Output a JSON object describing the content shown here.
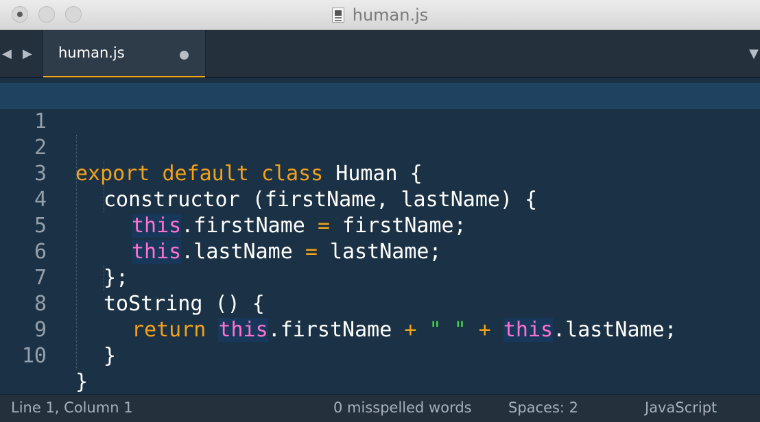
{
  "window": {
    "title": "human.js",
    "controls": [
      "close",
      "minimize",
      "zoom"
    ]
  },
  "tabs": {
    "nav_left_icon": "triangle-left-icon",
    "nav_right_icon": "triangle-right-icon",
    "menu_icon": "triangle-down-icon",
    "items": [
      {
        "label": "human.js",
        "active": true,
        "dirty": true
      }
    ]
  },
  "editor": {
    "current_line": 1,
    "lines": [
      {
        "number": "1"
      },
      {
        "number": "2"
      },
      {
        "number": "3"
      },
      {
        "number": "4"
      },
      {
        "number": "5"
      },
      {
        "number": "6"
      },
      {
        "number": "7"
      },
      {
        "number": "8"
      },
      {
        "number": "9"
      },
      {
        "number": "10"
      }
    ],
    "tokens": {
      "l2": [
        "export",
        " ",
        "default",
        " ",
        "class",
        " Human {"
      ],
      "l3": [
        "constructor (firstName, lastName) {"
      ],
      "l4": [
        "this",
        ".firstName ",
        "=",
        " firstName;"
      ],
      "l5": [
        "this",
        ".lastName ",
        "=",
        " lastName;"
      ],
      "l6": [
        "};"
      ],
      "l7": [
        "toString () {"
      ],
      "l8": [
        "return",
        " ",
        "this",
        ".firstName ",
        "+",
        " ",
        "\" \"",
        " ",
        "+",
        " ",
        "this",
        ".lastName;"
      ],
      "l9": [
        "}"
      ],
      "l10": [
        "}"
      ]
    },
    "colors": {
      "keyword": "#f3a217",
      "this": "#ff71d0",
      "string": "#46d24c",
      "text": "#ffffff",
      "background": "#1b3145"
    }
  },
  "status": {
    "position": "Line 1, Column 1",
    "spelling": "0 misspelled words",
    "indent": "Spaces: 2",
    "syntax": "JavaScript"
  }
}
